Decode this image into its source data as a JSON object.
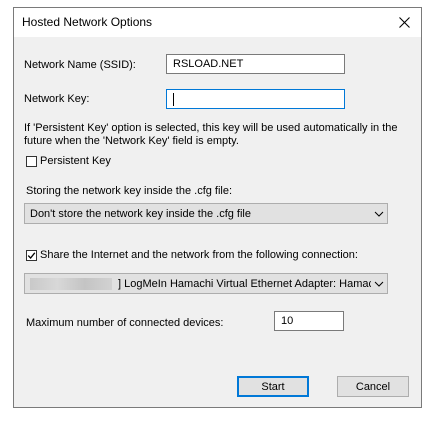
{
  "window": {
    "title": "Hosted Network Options",
    "close_icon": "close-icon"
  },
  "ssid": {
    "label": "Network Name (SSID):",
    "value": "RSLOAD.NET"
  },
  "network_key": {
    "label": "Network Key:",
    "value": ""
  },
  "persistent": {
    "info_line1": "If 'Persistent Key' option is selected, this key will be used automatically in the",
    "info_line2": "future when the 'Network Key' field is empty.",
    "checkbox_label": "Persistent Key",
    "checked": false
  },
  "storage": {
    "label": "Storing the network key inside the .cfg file:",
    "selected": "Don't store the network key inside the .cfg file"
  },
  "share": {
    "checkbox_label": "Share the Internet and the network from the following connection:",
    "checked": true,
    "connection_selected": "] LogMeIn Hamachi Virtual Ethernet Adapter: Hamach"
  },
  "max_devices": {
    "label": "Maximum number of connected devices:",
    "value": "10"
  },
  "buttons": {
    "start": "Start",
    "cancel": "Cancel"
  },
  "colors": {
    "accent": "#0078d7",
    "dialog_bg": "#f0f0f0",
    "button_bg": "#e1e1e1"
  }
}
